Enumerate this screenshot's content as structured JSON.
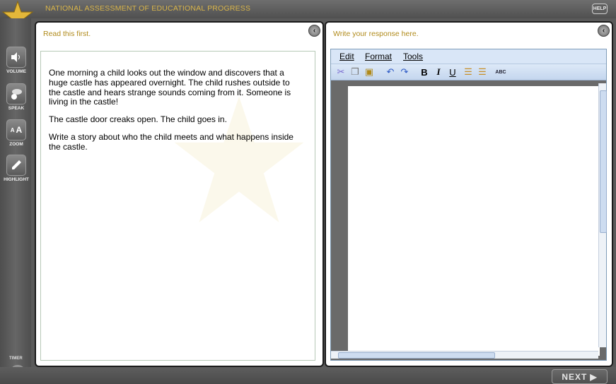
{
  "app": {
    "title": "NATIONAL ASSESSMENT OF EDUCATIONAL PROGRESS",
    "help": "HELP",
    "next": "NEXT"
  },
  "sidebar": {
    "tools": [
      {
        "label": "VOLUME",
        "icon": "speaker-icon"
      },
      {
        "label": "SPEAK",
        "icon": "speak-icon"
      },
      {
        "label": "ZOOM",
        "icon": "zoom-icon"
      },
      {
        "label": "HIGHLIGHT",
        "icon": "pen-icon"
      }
    ],
    "timer": "TIMER"
  },
  "left_panel": {
    "heading": "Read this first.",
    "paragraphs": [
      "One morning a child looks out the window and discovers that a huge castle has appeared overnight. The child rushes outside to the castle and hears strange sounds coming from it. Someone is living in the castle!",
      "The castle door creaks open. The child goes in.",
      "Write a story about who the child meets and what happens inside the castle."
    ]
  },
  "right_panel": {
    "heading": "Write your response here.",
    "menu": {
      "edit": "Edit",
      "format": "Format",
      "tools": "Tools"
    },
    "toolbar": {
      "bold": "B",
      "italic": "I",
      "underline": "U",
      "spell": "ABC"
    }
  },
  "colors": {
    "accent": "#b08a1a",
    "title": "#d9b54a",
    "editor_bar": "#d9e6f7"
  }
}
